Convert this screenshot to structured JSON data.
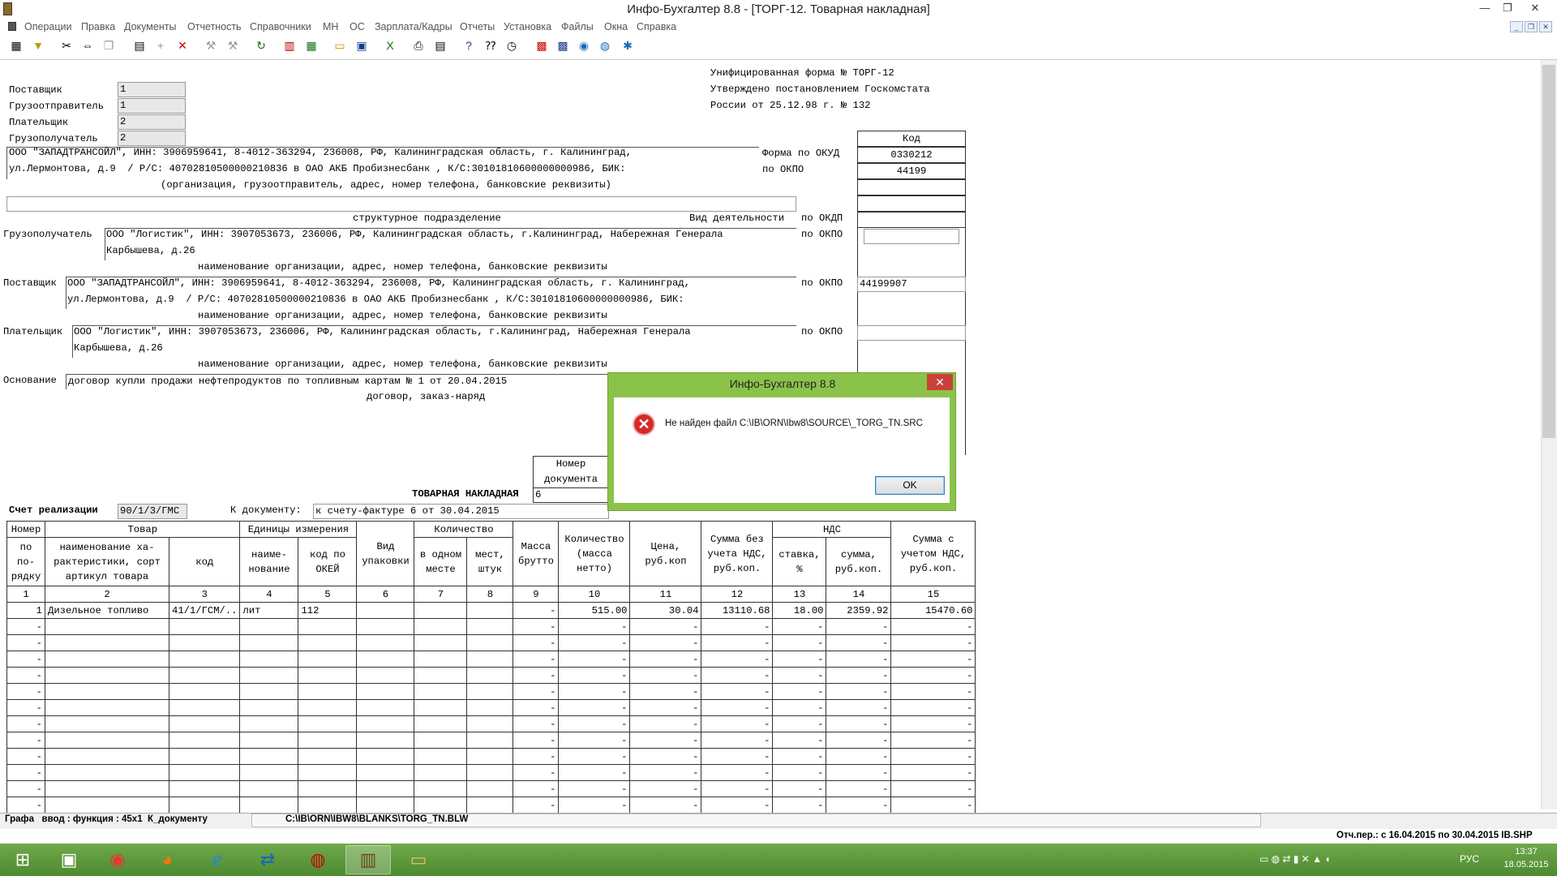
{
  "window": {
    "title": "Инфо-Бухгалтер 8.8 - [ТОРГ-12. Товарная накладная]",
    "controls": [
      "—",
      "❐",
      "✕"
    ]
  },
  "menu": {
    "items": [
      "Операции",
      "Правка",
      "Документы",
      "Отчетность",
      "Справочники",
      "МН",
      "ОС",
      "Зарплата/Кадры",
      "Отчеты",
      "Установка",
      "Файлы",
      "Окна",
      "Справка"
    ],
    "mdi_controls": [
      "_",
      "❐",
      "✕"
    ]
  },
  "toolbar": {
    "icons": [
      "grid-icon",
      "filter-icon",
      "cut-icon",
      "insert-icon",
      "copy-icon",
      "calc-icon",
      "add-icon",
      "delete-icon",
      "tool-icon",
      "tool2-icon",
      "refresh-icon",
      "report-icon",
      "table-icon",
      "open-icon",
      "save-icon",
      "excel-icon",
      "print-icon",
      "preview-icon",
      "help-icon",
      "context-help-icon",
      "clock-icon",
      "book-icon",
      "mn-icon",
      "update-icon",
      "web-icon",
      "settings-icon"
    ]
  },
  "form": {
    "header_lines": [
      "Унифицированная форма № ТОРГ-12",
      "Утверждено постановлением Госкомстата",
      "России от 25.12.98 г. № 132"
    ],
    "small_fields": [
      {
        "label": "Поставщик",
        "value": "1"
      },
      {
        "label": "Грузоотправитель",
        "value": "1"
      },
      {
        "label": "Плательщик",
        "value": "2"
      },
      {
        "label": "Грузополучатель",
        "value": "2"
      }
    ],
    "code_header": "Код",
    "okud_label": "Форма по ОКУД",
    "okud_code": "0330212",
    "okpo_label": "по ОКПО",
    "okpo_code": "44199",
    "shipper_line1": "ООО \"ЗАПАДТРАНСОЙЛ\", ИНН: 3906959641, 8-4012-363294, 236008, РФ, Калининградская область, г. Калининград,",
    "shipper_line2": "ул.Лермонтова, д.9  / Р/С: 40702810500000210836 в ОАО АКБ Пробизнесбанк , К/С:30101810600000000986, БИК:",
    "shipper_caption": "(организация, грузоотправитель, адрес, номер телефона, банковские реквизиты)",
    "division_caption": "структурное подразделение",
    "activity_label": "Вид деятельности",
    "okdp_label": "по ОКДП",
    "consignee_label": "Грузополучатель",
    "consignee_line1": "ООО \"Логистик\", ИНН: 3907053673, 236006, РФ, Калининградская область, г.Калининград, Набережная Генерала",
    "consignee_line2": "Карбышева, д.26",
    "org_caption": "наименование организации, адрес, номер телефона, банковские реквизиты",
    "supplier_label": "Поставщик",
    "supplier_line1": "ООО \"ЗАПАДТРАНСОЙЛ\", ИНН: 3906959641, 8-4012-363294, 236008, РФ, Калининградская область, г. Калининград,",
    "supplier_line2": "ул.Лермонтова, д.9  / Р/С: 40702810500000210836 в ОАО АКБ Пробизнесбанк , К/С:30101810600000000986, БИК:",
    "supplier_okpo": "44199907",
    "payer_label": "Плательщик",
    "payer_line1": "ООО \"Логистик\", ИНН: 3907053673, 236006, РФ, Калининградская область, г.Калининград, Набережная Генерала",
    "payer_line2": "Карбышева, д.26",
    "basis_label": "Основание",
    "basis_value": "договор купли продажи нефтепродуктов по топливным картам № 1 от 20.04.2015",
    "basis_caption": "договор, заказ-наряд",
    "doc_number_header": "Номер\nдокумента",
    "invoice_title": "ТОВАРНАЯ НАКЛАДНАЯ",
    "doc_number": "6",
    "sales_account_label": "Счет реализации",
    "sales_account": "90/1/3/ГМС",
    "to_document_label": "К документу:",
    "to_document": "к счету-фактуре 6 от 30.04.2015"
  },
  "table": {
    "group_headers": {
      "num": "Номер",
      "goods": "Товар",
      "units": "Единицы измерения",
      "qty": "Количество",
      "vat": "НДС"
    },
    "sub_headers": [
      "по\nпо-\nрядку",
      "наименование ха-\nрактеристики, сорт\nартикул товара",
      "код",
      "наиме-\nнование",
      "код по\nОКЕЙ",
      "Вид\nупаковки",
      "в одном\nместе",
      "мест,\nштук",
      "Масса\nбрутто",
      "Количество\n(масса\nнетто)",
      "Цена,\nруб.коп",
      "Сумма без\nучета НДС,\nруб.коп.",
      "ставка,\n%",
      "сумма,\nруб.коп.",
      "Сумма с\nучетом НДС,\nруб.коп."
    ],
    "col_numbers": [
      "1",
      "2",
      "3",
      "4",
      "5",
      "6",
      "7",
      "8",
      "9",
      "10",
      "11",
      "12",
      "13",
      "14",
      "15"
    ],
    "rows": [
      [
        "1",
        "Дизельное топливо",
        "41/1/ГСМ/..",
        "лит",
        "112",
        "",
        "",
        "",
        "-",
        "515.00",
        "30.04",
        "13110.68",
        "18.00",
        "2359.92",
        "15470.60"
      ],
      [
        "-",
        "",
        "",
        "",
        "",
        "",
        "",
        "",
        "-",
        "-",
        "-",
        "-",
        "-",
        "-",
        "-"
      ],
      [
        "-",
        "",
        "",
        "",
        "",
        "",
        "",
        "",
        "-",
        "-",
        "-",
        "-",
        "-",
        "-",
        "-"
      ],
      [
        "-",
        "",
        "",
        "",
        "",
        "",
        "",
        "",
        "-",
        "-",
        "-",
        "-",
        "-",
        "-",
        "-"
      ],
      [
        "-",
        "",
        "",
        "",
        "",
        "",
        "",
        "",
        "-",
        "-",
        "-",
        "-",
        "-",
        "-",
        "-"
      ],
      [
        "-",
        "",
        "",
        "",
        "",
        "",
        "",
        "",
        "-",
        "-",
        "-",
        "-",
        "-",
        "-",
        "-"
      ],
      [
        "-",
        "",
        "",
        "",
        "",
        "",
        "",
        "",
        "-",
        "-",
        "-",
        "-",
        "-",
        "-",
        "-"
      ],
      [
        "-",
        "",
        "",
        "",
        "",
        "",
        "",
        "",
        "-",
        "-",
        "-",
        "-",
        "-",
        "-",
        "-"
      ],
      [
        "-",
        "",
        "",
        "",
        "",
        "",
        "",
        "",
        "-",
        "-",
        "-",
        "-",
        "-",
        "-",
        "-"
      ],
      [
        "-",
        "",
        "",
        "",
        "",
        "",
        "",
        "",
        "-",
        "-",
        "-",
        "-",
        "-",
        "-",
        "-"
      ],
      [
        "-",
        "",
        "",
        "",
        "",
        "",
        "",
        "",
        "-",
        "-",
        "-",
        "-",
        "-",
        "-",
        "-"
      ],
      [
        "-",
        "",
        "",
        "",
        "",
        "",
        "",
        "",
        "-",
        "-",
        "-",
        "-",
        "-",
        "-",
        "-"
      ],
      [
        "-",
        "",
        "",
        "",
        "",
        "",
        "",
        "",
        "-",
        "-",
        "-",
        "-",
        "-",
        "-",
        "-"
      ]
    ]
  },
  "status": {
    "mode": "Графа   ввод : функция : 45x1  К_документу",
    "path": "C:\\IB\\ORN\\IBW8\\BLANKS\\TORG_TN.BLW",
    "period": "Отч.пер.: с 16.04.2015 по 30.04.2015 IB.SHP"
  },
  "dialog": {
    "title": "Инфо-Бухгалтер 8.8",
    "message": "Не найден файл C:\\IB\\ORN\\Ibw8\\SOURCE\\_TORG_TN.SRC",
    "ok_label": "OK",
    "close_glyph": "✕"
  },
  "taskbar": {
    "apps": [
      "start-icon",
      "explorer-app-icon",
      "chrome-icon",
      "firefox-icon",
      "ie-icon",
      "teamviewer-icon",
      "1c-icon",
      "infobuh-icon",
      "files-icon"
    ],
    "lang": "РУС",
    "time": "13:37",
    "date": "18.05.2015"
  }
}
